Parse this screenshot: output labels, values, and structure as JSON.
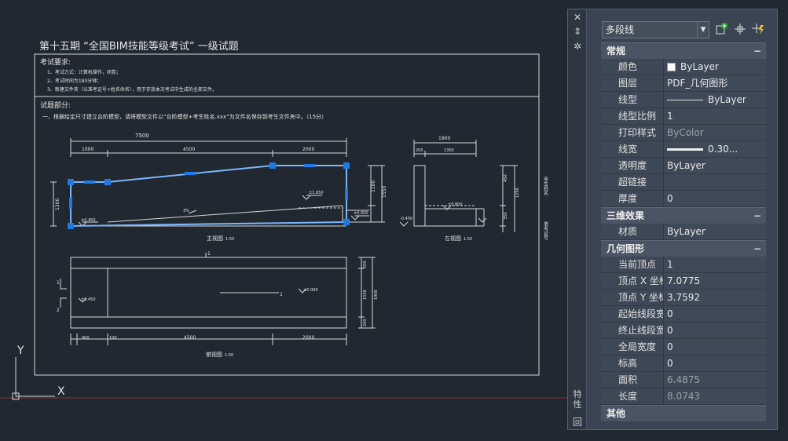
{
  "drawing": {
    "title": "第十五期 “全国BIM技能等级考试” 一级试题",
    "exam_requirements_header": "考试要求:",
    "exam_req_line1": "1、考试方式：计算机操作，闭卷；",
    "exam_req_line2": "2、考试时间为180分钟；",
    "exam_req_line3": "3、新建文件夹（以准考证号+姓名命名），用于存放本次考试中生成的全部文件。",
    "questions_header": "试题部分:",
    "question1": "一、根据给定尺寸建立台阶模型，请将模型文件以“台阶模型+考生姓名.xxx”为文件名保存到考生文件夹中。（15分）",
    "view_front": "主视图",
    "view_left": "左视图",
    "view_top": "俯视图",
    "scale": "1:50",
    "dim_7500": "7500",
    "dim_1000": "1000",
    "dim_4500": "4500",
    "dim_2000": "2000",
    "dim_1900": "1900",
    "dim_1350": "1350",
    "dim_200": "200",
    "dim_900": "900",
    "dim_100": "100",
    "dim_1100": "1100",
    "dim_1550": "1550",
    "dim_1250": "1250",
    "dim_450": "450",
    "dim_350": "350",
    "dim_800": "800",
    "dim_1200": "1200",
    "elev_0450": "±0.450",
    "elev_1650": "±1.650",
    "elev_0000": "±0.000",
    "elev_m0450": "-0.450",
    "elev_0800": "±0.800",
    "slope_label": "3%",
    "section_1": "1",
    "section_2": "2",
    "side_text_1": "考生姓名",
    "side_text_2": "准考证号",
    "ucs_y": "Y",
    "ucs_x": "X"
  },
  "palette": {
    "side_label": "特性",
    "close_glyph": "✕",
    "pin_glyph": "⇕",
    "options_glyph": "✲",
    "bottom_glyph": "回",
    "object_type": "多段线",
    "sections": [
      {
        "title": "常规",
        "collapse": "−",
        "rows": [
          {
            "name": "颜色",
            "value": "ByLayer",
            "kind": "color"
          },
          {
            "name": "图层",
            "value": "PDF_几何图形"
          },
          {
            "name": "线型",
            "value": "ByLayer",
            "kind": "ltype"
          },
          {
            "name": "线型比例",
            "value": "1"
          },
          {
            "name": "打印样式",
            "value": "ByColor",
            "readonly": true
          },
          {
            "name": "线宽",
            "value": "0.30...",
            "kind": "lweight"
          },
          {
            "name": "透明度",
            "value": "ByLayer"
          },
          {
            "name": "超链接",
            "value": ""
          },
          {
            "name": "厚度",
            "value": "0"
          }
        ]
      },
      {
        "title": "三维效果",
        "collapse": "−",
        "rows": [
          {
            "name": "材质",
            "value": "ByLayer"
          }
        ]
      },
      {
        "title": "几何图形",
        "collapse": "−",
        "rows": [
          {
            "name": "当前顶点",
            "value": "1"
          },
          {
            "name": "顶点 X 坐标",
            "value": "7.0775"
          },
          {
            "name": "顶点 Y 坐标",
            "value": "3.7592"
          },
          {
            "name": "起始线段宽度",
            "value": "0"
          },
          {
            "name": "终止线段宽度",
            "value": "0"
          },
          {
            "name": "全局宽度",
            "value": "0"
          },
          {
            "name": "标高",
            "value": "0"
          },
          {
            "name": "面积",
            "value": "6.4875",
            "readonly": true
          },
          {
            "name": "长度",
            "value": "8.0743",
            "readonly": true
          }
        ]
      },
      {
        "title": "其他",
        "collapse": "",
        "rows": []
      }
    ]
  },
  "colors": {
    "background": "#212830",
    "selection": "#1e7ae6",
    "axis_red": "#8a2f3a"
  }
}
